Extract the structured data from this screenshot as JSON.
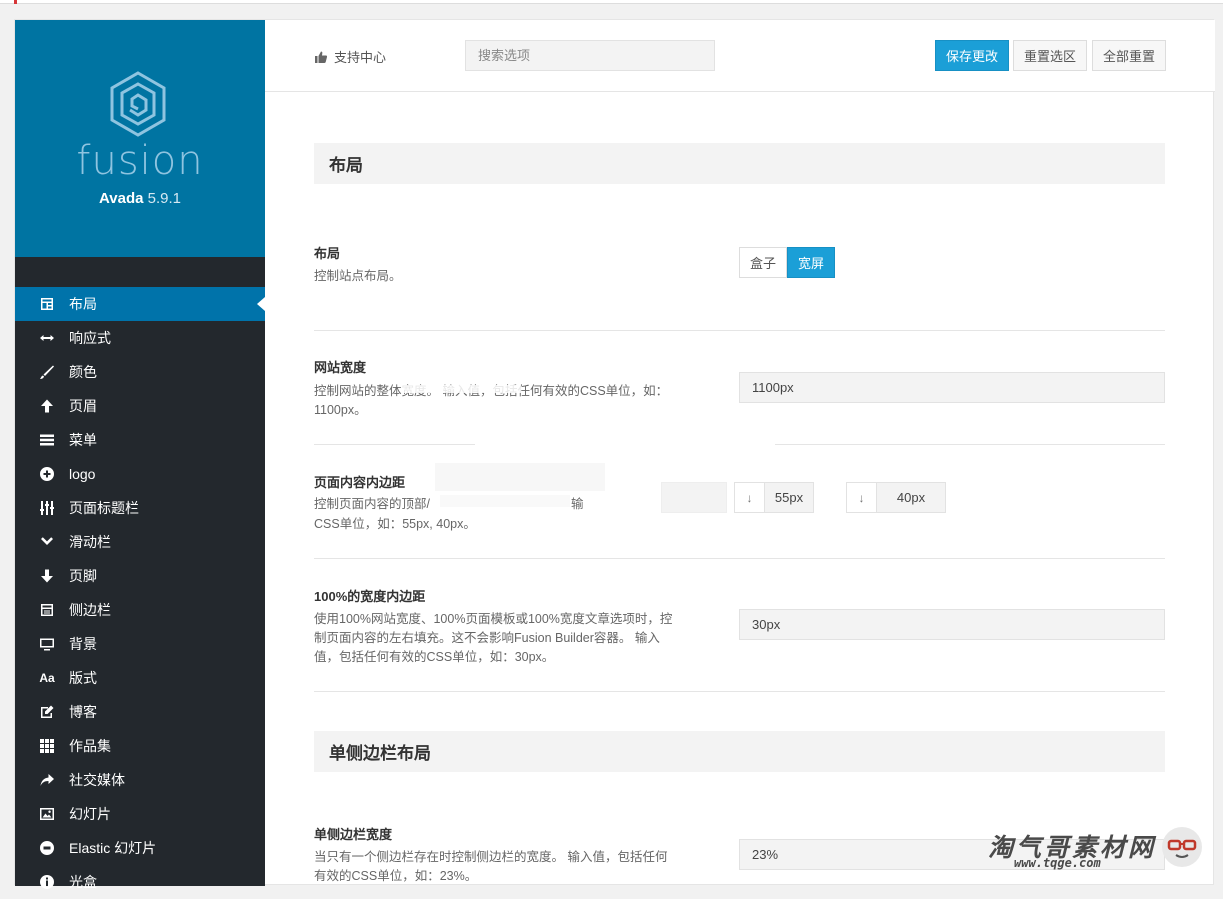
{
  "brand": {
    "wordmark": "fusion",
    "name": "Avada",
    "version": "5.9.1"
  },
  "sidebar": {
    "items": [
      {
        "label": "布局",
        "icon": "layout-icon",
        "active": true
      },
      {
        "label": "响应式",
        "icon": "arrows-horizontal-icon"
      },
      {
        "label": "颜色",
        "icon": "brush-icon"
      },
      {
        "label": "页眉",
        "icon": "arrow-up-icon"
      },
      {
        "label": "菜单",
        "icon": "menu-lines-icon"
      },
      {
        "label": "logo",
        "icon": "plus-circle-icon"
      },
      {
        "label": "页面标题栏",
        "icon": "sliders-icon"
      },
      {
        "label": "滑动栏",
        "icon": "chevron-down-icon"
      },
      {
        "label": "页脚",
        "icon": "arrow-down-icon"
      },
      {
        "label": "侧边栏",
        "icon": "sidebar-icon"
      },
      {
        "label": "背景",
        "icon": "monitor-icon"
      },
      {
        "label": "版式",
        "icon": "typography-icon"
      },
      {
        "label": "博客",
        "icon": "edit-icon"
      },
      {
        "label": "作品集",
        "icon": "grid-icon"
      },
      {
        "label": "社交媒体",
        "icon": "share-icon"
      },
      {
        "label": "幻灯片",
        "icon": "image-icon"
      },
      {
        "label": "Elastic 幻灯片",
        "icon": "minus-circle-icon"
      },
      {
        "label": "光盒",
        "icon": "info-icon"
      }
    ]
  },
  "header": {
    "support_label": "支持中心",
    "search_placeholder": "搜索选项",
    "save_label": "保存更改",
    "reset_section_label": "重置选区",
    "reset_all_label": "全部重置"
  },
  "content": {
    "section1_title": "布局",
    "layout": {
      "title": "布局",
      "desc": "控制站点布局。",
      "option_boxed": "盒子",
      "option_wide": "宽屏"
    },
    "site_width": {
      "title": "网站宽度",
      "desc": "控制网站的整体宽度。 输入值，包括任何有效的CSS单位，如：1100px。",
      "value": "1100px"
    },
    "page_padding": {
      "title": "页面内容内边距",
      "desc_line1": "控制页面内容的顶部/",
      "desc_line1b": "输",
      "desc_line2": "CSS单位，如：55px, 40px。",
      "top_value": "55px",
      "bottom_value": "40px"
    },
    "hundred_padding": {
      "title": "100%的宽度内边距",
      "desc": "使用100%网站宽度、100%页面模板或100%宽度文章选项时，控制页面内容的左右填充。这不会影响Fusion Builder容器。 输入值，包括任何有效的CSS单位，如：30px。",
      "value": "30px"
    },
    "section2_title": "单侧边栏布局",
    "single_sidebar": {
      "title": "单侧边栏宽度",
      "desc": "当只有一个侧边栏存在时控制侧边栏的宽度。 输入值，包括任何有效的CSS单位，如：23%。",
      "value": "23%"
    }
  },
  "watermark": {
    "text": "淘气哥素材网",
    "url": "www.tqge.com"
  },
  "colors": {
    "brand_blue": "#0074a2",
    "sidebar_dark": "#23282d",
    "accent": "#1b9fd7"
  }
}
